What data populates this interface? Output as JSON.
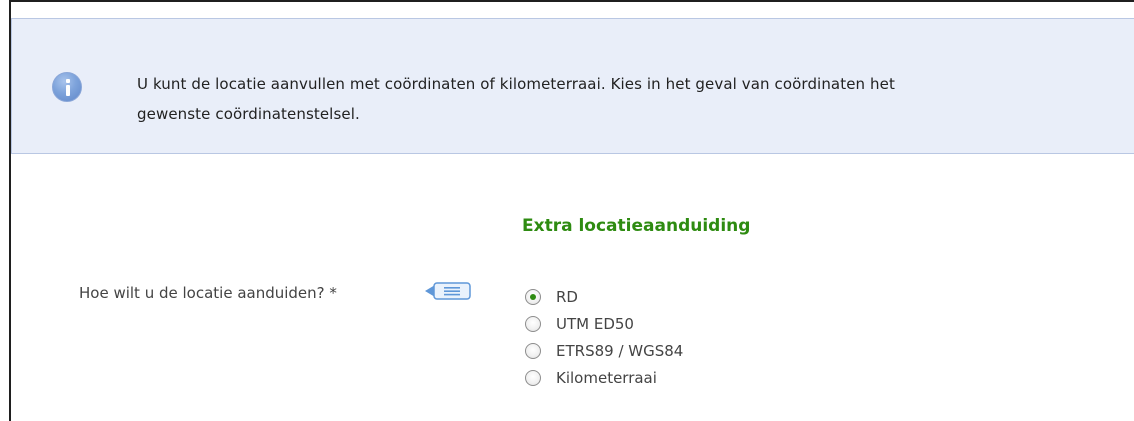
{
  "info": {
    "icon": "info-icon",
    "line1": "U kunt de locatie aanvullen met coördinaten of kilometerraai. Kies in het geval van coördinaten het",
    "line2": "gewenste coördinatenstelsel."
  },
  "section": {
    "title": "Extra locatieaanduiding"
  },
  "question": {
    "label": "Hoe wilt u de locatie aanduiden? *",
    "help_icon": "help-speech-bubble-icon",
    "options": [
      {
        "label": "RD",
        "selected": true
      },
      {
        "label": "UTM ED50",
        "selected": false
      },
      {
        "label": "ETRS89 / WGS84",
        "selected": false
      },
      {
        "label": "Kilometerraai",
        "selected": false
      }
    ]
  },
  "colors": {
    "accent_green": "#2e8b11",
    "info_background": "#e9eef9",
    "info_border": "#b9c7e3"
  }
}
